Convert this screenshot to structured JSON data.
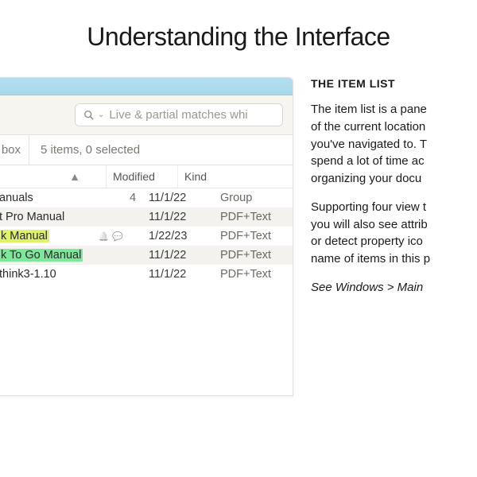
{
  "page_title": "Understanding the Interface",
  "window": {
    "search_placeholder": "Live & partial matches whi",
    "status": {
      "left": "box",
      "summary": "5 items, 0 selected"
    },
    "columns": {
      "modified": "Modified",
      "kind": "Kind"
    },
    "rows": [
      {
        "name": "anuals",
        "count": "4",
        "modified": "11/1/22",
        "kind": "Group",
        "hl": "",
        "icons": []
      },
      {
        "name": "t Pro Manual",
        "count": "",
        "modified": "11/1/22",
        "kind": "PDF+Text",
        "hl": "",
        "icons": []
      },
      {
        "name": "k Manual",
        "count": "",
        "modified": "1/22/23",
        "kind": "PDF+Text",
        "hl": "yellow",
        "icons": [
          "bell",
          "comment"
        ]
      },
      {
        "name": "k To Go Manual",
        "count": "",
        "modified": "11/1/22",
        "kind": "PDF+Text",
        "hl": "green",
        "icons": []
      },
      {
        "name": "think3-1.10",
        "count": "",
        "modified": "11/1/22",
        "kind": "PDF+Text",
        "hl": "",
        "icons": []
      }
    ]
  },
  "side": {
    "heading": "THE ITEM LIST",
    "p1": [
      "The item list is a pane",
      "of the current location",
      "you've navigated to. T",
      "spend a lot of time ac",
      "organizing your docu"
    ],
    "p2": [
      "Supporting four view t",
      "you will also see attrib",
      "or detect property ico",
      "name of items in this p"
    ],
    "see": "See Windows > Main "
  }
}
